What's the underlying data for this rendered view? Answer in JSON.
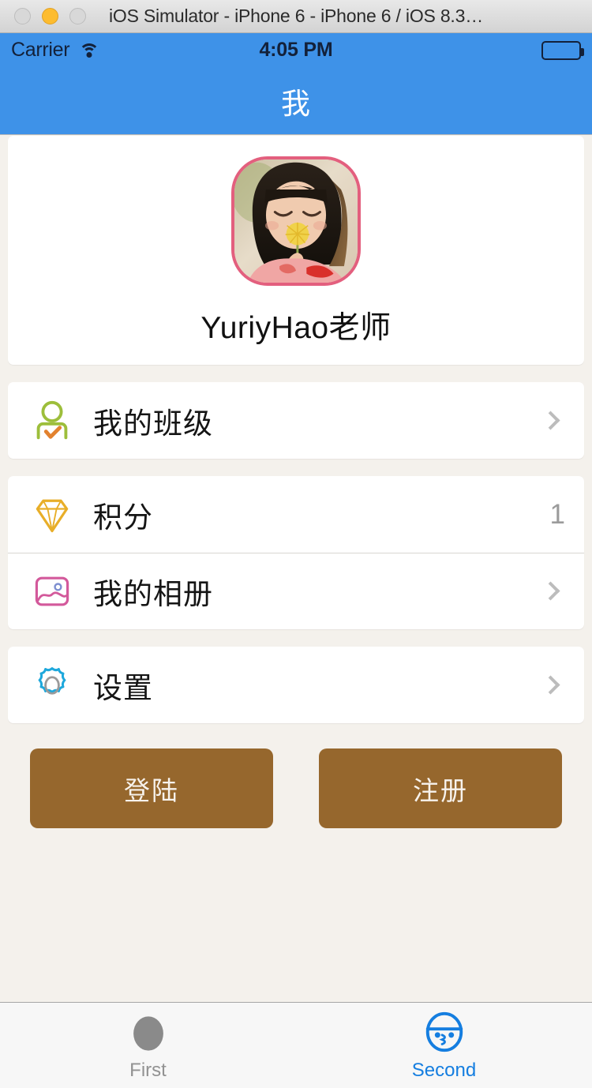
{
  "window": {
    "title": "iOS Simulator - iPhone 6 - iPhone 6 / iOS 8.3…",
    "close_icon": "close-traffic-light",
    "minimize_icon": "minimize-traffic-light",
    "zoom_icon": "zoom-traffic-light"
  },
  "status_bar": {
    "carrier": "Carrier",
    "wifi_icon": "wifi-icon",
    "time": "4:05 PM",
    "battery_icon": "battery-full-icon"
  },
  "nav": {
    "title": "我"
  },
  "profile": {
    "avatar_icon": "user-avatar-photo",
    "avatar_alt": "girl blowing dandelion",
    "name": "YuriyHao老师"
  },
  "menu": [
    {
      "label": "我的班级",
      "icon": "user-check-icon",
      "icon_color": "#9DBE3B",
      "accent_color": "#E2822F",
      "accessory": "chevron",
      "value": ""
    },
    {
      "label": "积分",
      "icon": "diamond-icon",
      "icon_color": "#E8AE28",
      "accent_color": "#E8AE28",
      "accessory": "value",
      "value": "1"
    },
    {
      "label": "我的相册",
      "icon": "photo-icon",
      "icon_color": "#D3599B",
      "accent_color": "#7E8FD0",
      "accessory": "chevron",
      "value": ""
    },
    {
      "label": "设置",
      "icon": "gear-icon",
      "icon_color": "#1EA8DC",
      "accent_color": "#9A9A9A",
      "accessory": "chevron",
      "value": ""
    }
  ],
  "buttons": {
    "login": "登陆",
    "register": "注册",
    "color": "#96672D"
  },
  "tabbar": [
    {
      "label": "First",
      "icon": "circle-icon",
      "active": false,
      "color": "#929292"
    },
    {
      "label": "Second",
      "icon": "face-icon",
      "active": true,
      "color": "#157EE0"
    }
  ],
  "colors": {
    "nav_blue": "#3E92E8",
    "page_bg": "#F4F1EC",
    "card_bg": "#FFFFFF"
  }
}
